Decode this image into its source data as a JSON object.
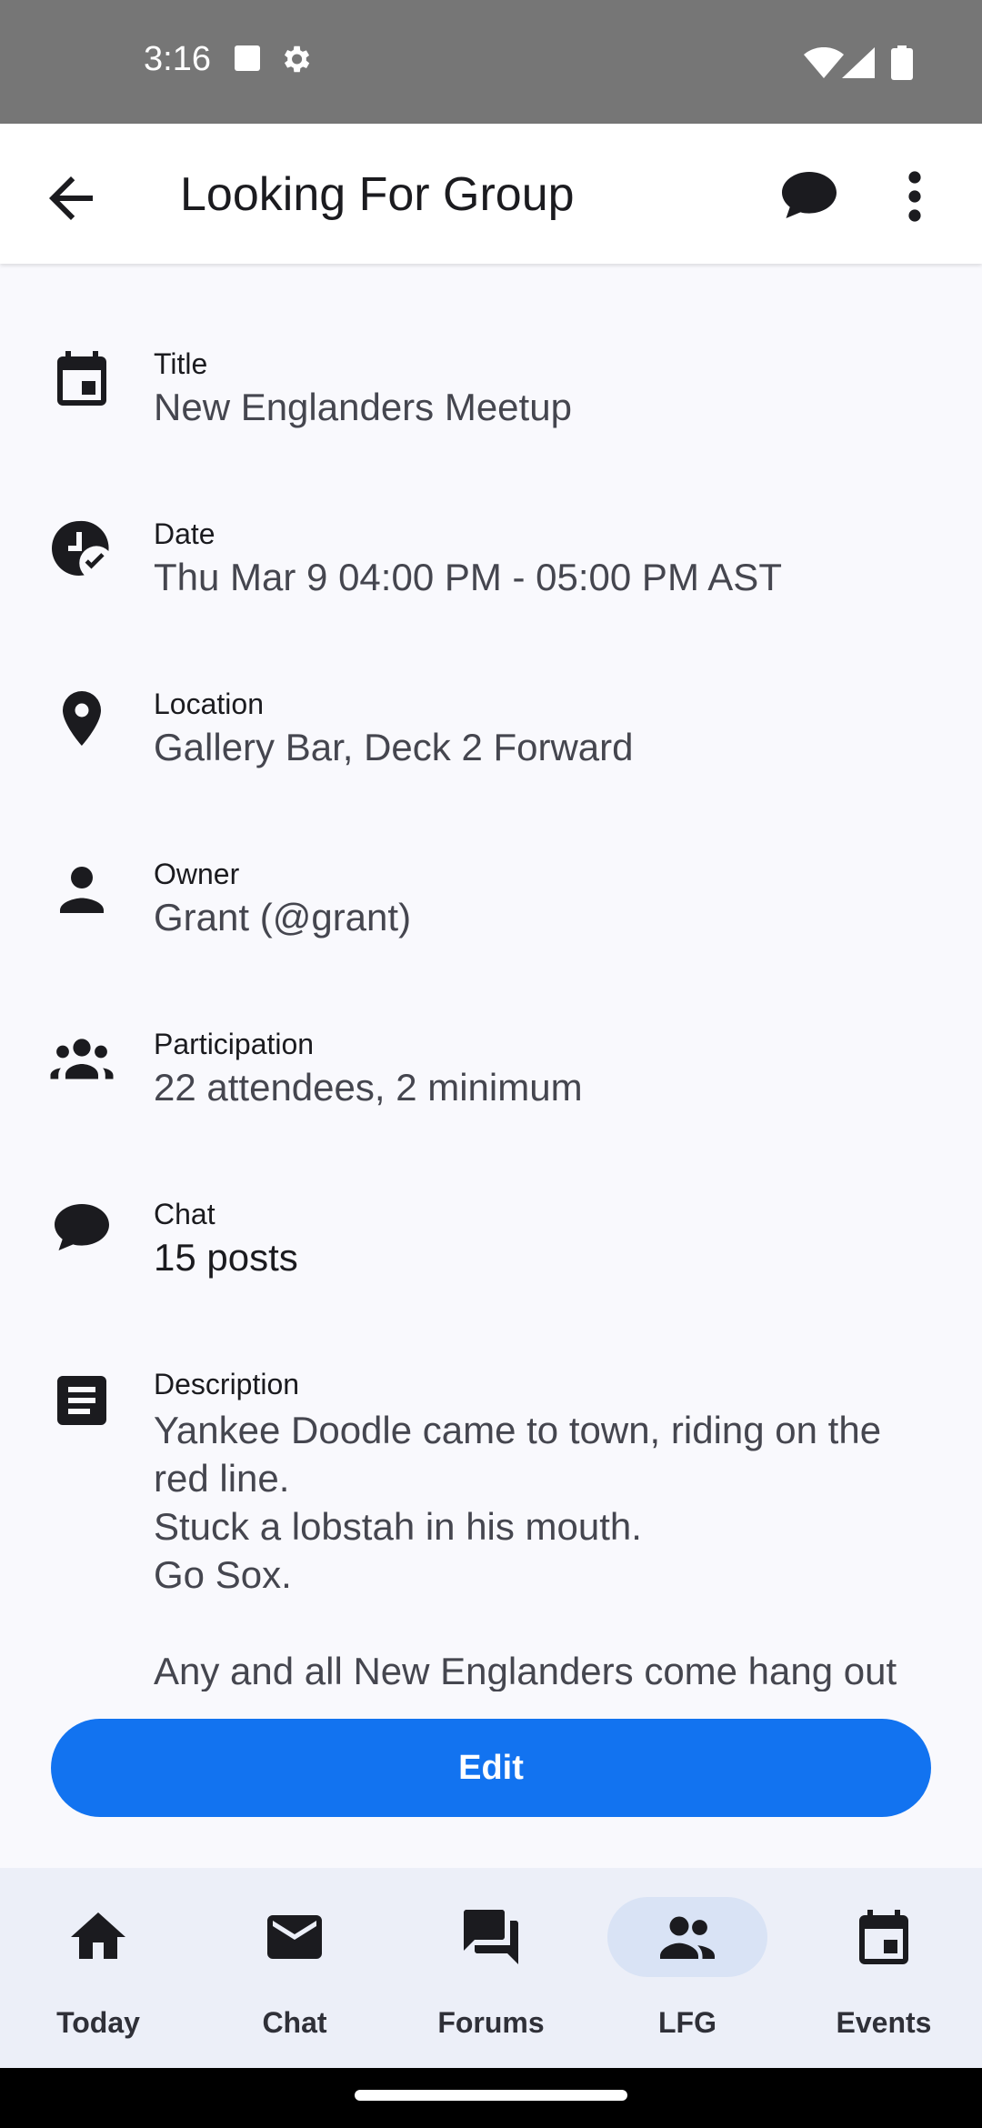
{
  "status_bar": {
    "time": "3:16"
  },
  "app_bar": {
    "title": "Looking For Group"
  },
  "details": [
    {
      "id": "title",
      "icon": "calendar-event-icon",
      "label": "Title",
      "value": "New Englanders Meetup"
    },
    {
      "id": "date",
      "icon": "clock-check-icon",
      "label": "Date",
      "value": "Thu Mar 9 04:00 PM - 05:00 PM AST"
    },
    {
      "id": "location",
      "icon": "location-pin-icon",
      "label": "Location",
      "value": "Gallery Bar, Deck 2 Forward"
    },
    {
      "id": "owner",
      "icon": "person-icon",
      "label": "Owner",
      "value": "Grant (@grant)"
    },
    {
      "id": "participation",
      "icon": "group-icon",
      "label": "Participation",
      "value": "22 attendees, 2 minimum"
    },
    {
      "id": "chat",
      "icon": "chat-bubble-icon",
      "label": "Chat",
      "value": "15 posts"
    }
  ],
  "description": {
    "label": "Description",
    "text": "Yankee Doodle came to town, riding on the red line.\nStuck a lobstah in his mouth.\nGo Sox.\n\nAny and all New Englanders come hang out before show/dinner. The Gallery Bar"
  },
  "actions": {
    "edit_label": "Edit"
  },
  "bottom_nav": {
    "items": [
      {
        "label": "Today",
        "icon": "home-icon",
        "active": false
      },
      {
        "label": "Chat",
        "icon": "mail-icon",
        "active": false
      },
      {
        "label": "Forums",
        "icon": "forum-icon",
        "active": false
      },
      {
        "label": "LFG",
        "icon": "group-icon",
        "active": true
      },
      {
        "label": "Events",
        "icon": "calendar-icon",
        "active": false
      }
    ]
  },
  "colors": {
    "accent": "#1273f0",
    "nav_active_pill": "#d9e3f5",
    "nav_background": "#eceff8",
    "status_bar": "#767676"
  }
}
